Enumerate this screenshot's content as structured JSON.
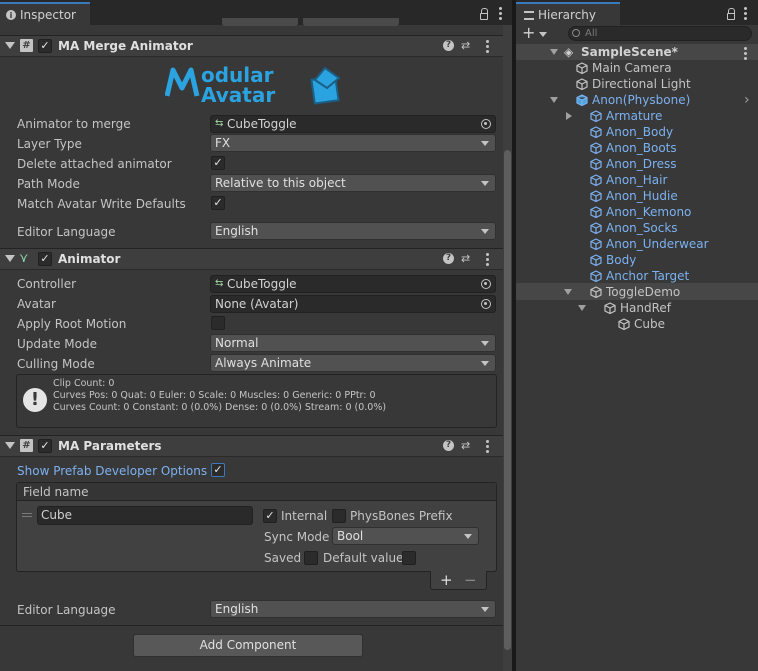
{
  "inspector": {
    "tab_label": "Inspector",
    "ma_merge": {
      "title": "MA Merge Animator",
      "logo_top": "odular",
      "logo_bottom": "Avatar",
      "rows": [
        {
          "label": "Animator to merge",
          "value": "CubeToggle"
        },
        {
          "label": "Layer Type",
          "value": "FX"
        },
        {
          "label": "Delete attached animator"
        },
        {
          "label": "Path Mode",
          "value": "Relative to this object"
        },
        {
          "label": "Match Avatar Write Defaults"
        },
        {
          "label": "Editor Language",
          "value": "English"
        }
      ]
    },
    "animator": {
      "title": "Animator",
      "rows": [
        {
          "label": "Controller",
          "value": "CubeToggle"
        },
        {
          "label": "Avatar",
          "value": "None (Avatar)"
        },
        {
          "label": "Apply Root Motion"
        },
        {
          "label": "Update Mode",
          "value": "Normal"
        },
        {
          "label": "Culling Mode",
          "value": "Always Animate"
        }
      ],
      "help_lines": [
        "Clip Count: 0",
        "Curves Pos: 0 Quat: 0 Euler: 0 Scale: 0 Muscles: 0 Generic: 0 PPtr: 0",
        "Curves Count: 0 Constant: 0 (0.0%) Dense: 0 (0.0%) Stream: 0 (0.0%)"
      ]
    },
    "ma_params": {
      "title": "MA Parameters",
      "show_prefab": "Show Prefab Developer Options",
      "field_name_header": "Field name",
      "param_name": "Cube",
      "internal": "Internal",
      "physbones": "PhysBones Prefix",
      "sync_mode_label": "Sync Mode",
      "sync_mode_value": "Bool",
      "saved": "Saved",
      "default_value": "Default value",
      "plus": "+",
      "minus": "−",
      "editor_language_label": "Editor Language",
      "editor_language_value": "English"
    },
    "add_component": "Add Component"
  },
  "hierarchy": {
    "tab_label": "Hierarchy",
    "add": "+",
    "search_placeholder": "All",
    "scene": "SampleScene*",
    "items": [
      {
        "name": "Main Camera",
        "blue": false
      },
      {
        "name": "Directional Light",
        "blue": false
      },
      {
        "name": "Anon(Physbone)",
        "blue": true
      },
      {
        "name": "Armature",
        "blue": true
      },
      {
        "name": "Anon_Body",
        "blue": true
      },
      {
        "name": "Anon_Boots",
        "blue": true
      },
      {
        "name": "Anon_Dress",
        "blue": true
      },
      {
        "name": "Anon_Hair",
        "blue": true
      },
      {
        "name": "Anon_Hudie",
        "blue": true
      },
      {
        "name": "Anon_Kemono",
        "blue": true
      },
      {
        "name": "Anon_Socks",
        "blue": true
      },
      {
        "name": "Anon_Underwear",
        "blue": true
      },
      {
        "name": "Body",
        "blue": true
      },
      {
        "name": "Anchor Target",
        "blue": true
      },
      {
        "name": "ToggleDemo",
        "blue": false
      },
      {
        "name": "HandRef",
        "blue": false
      },
      {
        "name": "Cube",
        "blue": false
      }
    ]
  },
  "colors": {
    "accent": "#3a79bb",
    "prefab_blue": "#7cb1f0",
    "logo_blue": "#2aa3e0"
  },
  "icons": [
    "info-icon",
    "lock-icon",
    "kebab-icon",
    "help-icon",
    "settings-sliders-icon",
    "script-icon",
    "animator-icon",
    "warning-icon",
    "gameobject-icon",
    "prefab-icon",
    "unity-scene-icon",
    "search-icon"
  ]
}
